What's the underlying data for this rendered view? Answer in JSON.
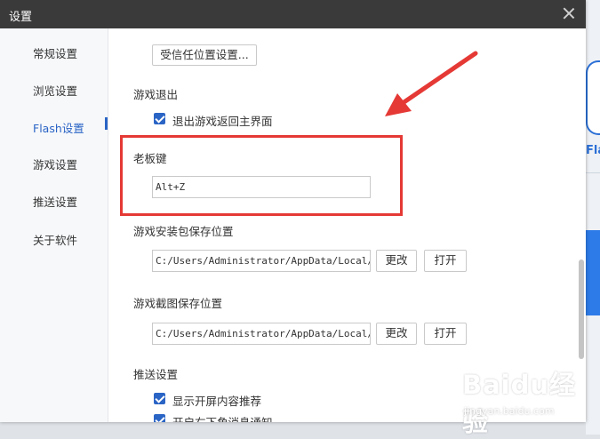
{
  "window": {
    "title": "设置"
  },
  "sidebar": {
    "items": [
      {
        "label": "常规设置"
      },
      {
        "label": "浏览设置"
      },
      {
        "label": "Flash设置",
        "active": true
      },
      {
        "label": "游戏设置"
      },
      {
        "label": "推送设置"
      },
      {
        "label": "关于软件"
      }
    ]
  },
  "content": {
    "trusted_location_button": "受信任位置设置...",
    "game_exit": {
      "heading": "游戏退出",
      "checkbox_label": "退出游戏返回主界面",
      "checked": true
    },
    "boss_key": {
      "heading": "老板键",
      "value": "Alt+Z"
    },
    "install_path": {
      "heading": "游戏安装包保存位置",
      "value": "C:/Users/Administrator/AppData/Local/Flas",
      "change_button": "更改",
      "open_button": "打开"
    },
    "screenshot_path": {
      "heading": "游戏截图保存位置",
      "value": "C:/Users/Administrator/AppData/Local/Flas",
      "change_button": "更改",
      "open_button": "打开"
    },
    "push": {
      "heading": "推送设置",
      "options": [
        {
          "label": "显示开屏内容推荐",
          "checked": true
        },
        {
          "label": "开启右下角消息通知",
          "checked": true
        }
      ]
    }
  },
  "background_app": {
    "partial_text": "Fla"
  },
  "watermark": {
    "logo": "Baidu经验",
    "url": "jingyan.baidu.com"
  },
  "colors": {
    "accent": "#2a64c5",
    "annotation": "#e53935",
    "titlebar": "#3a3a3a"
  }
}
